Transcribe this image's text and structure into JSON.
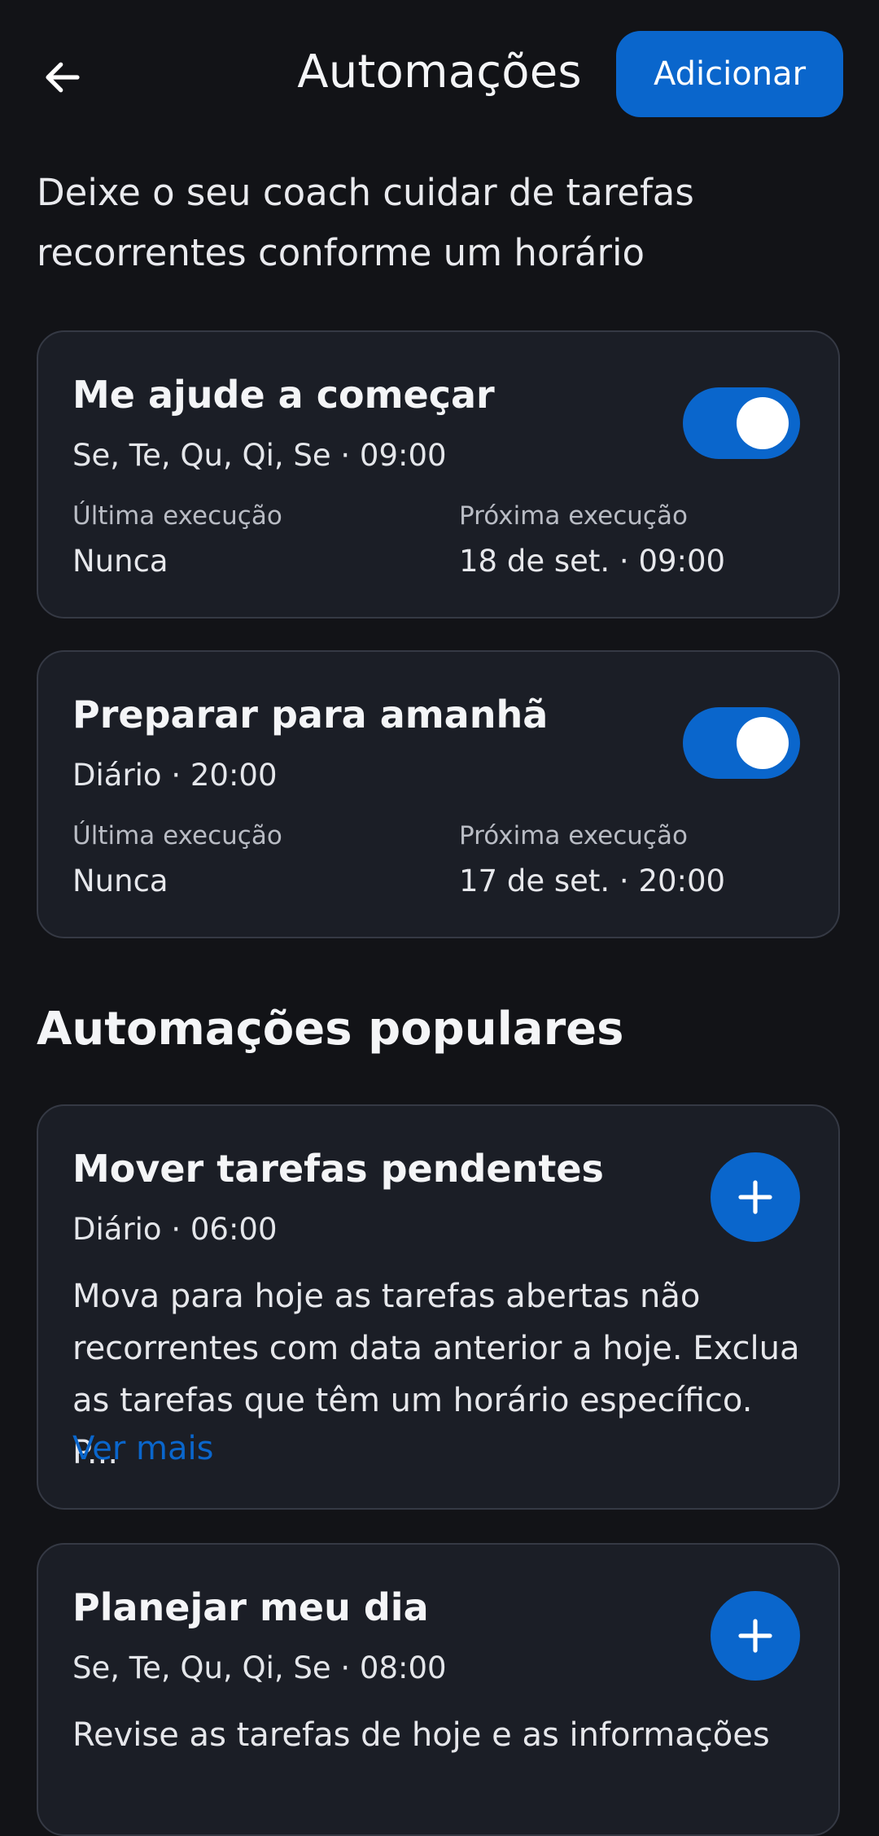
{
  "header": {
    "title": "Automações",
    "add_label": "Adicionar"
  },
  "intro": "Deixe o seu coach cuidar de tarefas recorrentes conforme um horário",
  "automations": [
    {
      "title": "Me ajude a começar",
      "schedule": "Se, Te, Qu, Qi, Se · 09:00",
      "enabled": true,
      "last_label": "Última execução",
      "last_value": "Nunca",
      "next_label": "Próxima execução",
      "next_value": "18 de set. · 09:00"
    },
    {
      "title": "Preparar para amanhã",
      "schedule": "Diário · 20:00",
      "enabled": true,
      "last_label": "Última execução",
      "last_value": "Nunca",
      "next_label": "Próxima execução",
      "next_value": "17 de set. · 20:00"
    }
  ],
  "popular": {
    "title": "Automações populares",
    "items": [
      {
        "title": "Mover tarefas pendentes",
        "schedule": "Diário · 06:00",
        "description": "Mova para hoje as tarefas abertas não recorrentes com data anterior a hoje. Exclua as tarefas que têm um horário específico. P...",
        "more_label": "Ver mais"
      },
      {
        "title": "Planejar meu dia",
        "schedule": "Se, Te, Qu, Qi, Se · 08:00",
        "description": "Revise as tarefas de hoje e as informações"
      }
    ]
  },
  "icons": {
    "back": "arrow-left-icon",
    "add": "plus-icon"
  },
  "colors": {
    "background": "#121317",
    "card": "#1b1e26",
    "accent": "#0a66cc"
  }
}
